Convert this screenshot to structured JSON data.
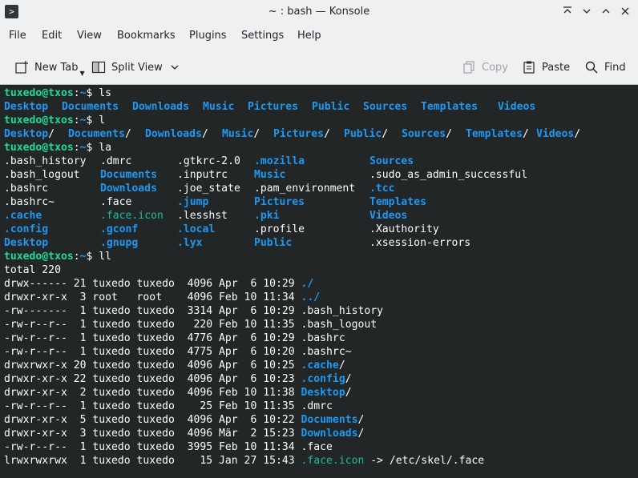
{
  "window": {
    "title": "~ : bash — Konsole"
  },
  "menu": [
    "File",
    "Edit",
    "View",
    "Bookmarks",
    "Plugins",
    "Settings",
    "Help"
  ],
  "toolbar": {
    "new_tab": "New Tab",
    "split_view": "Split View",
    "copy": "Copy",
    "paste": "Paste",
    "find": "Find"
  },
  "colors": {
    "terminal_bg": "#232627",
    "prompt": "#1cdc9a",
    "directory": "#1d99f3",
    "symlink": "#1abc9c",
    "text": "#fcfcfc"
  },
  "prompt": {
    "user_host": "tuxedo@txos",
    "sep": ":",
    "path": "~",
    "symbol": "$ "
  },
  "terminal": {
    "cmd1": "ls",
    "ls_dirs": [
      "Desktop",
      "Documents",
      "Downloads",
      "Music",
      "Pictures",
      "Public",
      "Sources",
      "Templates",
      "Videos"
    ],
    "cmd2": "l",
    "l_entries": [
      {
        "name": "Desktop",
        "suffix": "/"
      },
      {
        "name": "Documents",
        "suffix": "/"
      },
      {
        "name": "Downloads",
        "suffix": "/"
      },
      {
        "name": "Music",
        "suffix": "/"
      },
      {
        "name": "Pictures",
        "suffix": "/"
      },
      {
        "name": "Public",
        "suffix": "/"
      },
      {
        "name": "Sources",
        "suffix": "/"
      },
      {
        "name": "Templates",
        "suffix": "/"
      },
      {
        "name": "Videos",
        "suffix": "/"
      }
    ],
    "cmd3": "la",
    "la_columns": [
      [
        {
          "t": ".bash_history",
          "k": "plain"
        },
        {
          "t": ".bash_logout",
          "k": "plain"
        },
        {
          "t": ".bashrc",
          "k": "plain"
        },
        {
          "t": ".bashrc~",
          "k": "plain"
        },
        {
          "t": ".cache",
          "k": "dir"
        },
        {
          "t": ".config",
          "k": "dir"
        },
        {
          "t": "Desktop",
          "k": "dir"
        }
      ],
      [
        {
          "t": ".dmrc",
          "k": "plain"
        },
        {
          "t": "Documents",
          "k": "dir"
        },
        {
          "t": "Downloads",
          "k": "dir"
        },
        {
          "t": ".face",
          "k": "plain"
        },
        {
          "t": ".face.icon",
          "k": "link"
        },
        {
          "t": ".gconf",
          "k": "dir"
        },
        {
          "t": ".gnupg",
          "k": "dir"
        }
      ],
      [
        {
          "t": ".gtkrc-2.0",
          "k": "plain"
        },
        {
          "t": ".inputrc",
          "k": "plain"
        },
        {
          "t": ".joe_state",
          "k": "plain"
        },
        {
          "t": ".jump",
          "k": "dir"
        },
        {
          "t": ".lesshst",
          "k": "plain"
        },
        {
          "t": ".local",
          "k": "dir"
        },
        {
          "t": ".lyx",
          "k": "dir"
        }
      ],
      [
        {
          "t": ".mozilla",
          "k": "dir"
        },
        {
          "t": "Music",
          "k": "dir"
        },
        {
          "t": ".pam_environment",
          "k": "plain"
        },
        {
          "t": "Pictures",
          "k": "dir"
        },
        {
          "t": ".pki",
          "k": "dir"
        },
        {
          "t": ".profile",
          "k": "plain"
        },
        {
          "t": "Public",
          "k": "plain_dir"
        }
      ],
      [
        {
          "t": "Sources",
          "k": "dir"
        },
        {
          "t": ".sudo_as_admin_successful",
          "k": "plain"
        },
        {
          "t": ".tcc",
          "k": "dir"
        },
        {
          "t": "Templates",
          "k": "dir"
        },
        {
          "t": "Videos",
          "k": "dir"
        },
        {
          "t": ".Xauthority",
          "k": "plain"
        },
        {
          "t": ".xsession-errors",
          "k": "plain"
        }
      ]
    ],
    "cmd4": "ll",
    "total": "total 220",
    "ll_rows": [
      {
        "meta": "drwx------ 21 tuxedo tuxedo  4096 Apr  6 10:29 ",
        "name": "./",
        "k": "dirslash"
      },
      {
        "meta": "drwxr-xr-x  3 root   root    4096 Feb 10 11:34 ",
        "name": "../",
        "k": "dirslash"
      },
      {
        "meta": "-rw-------  1 tuxedo tuxedo  3314 Apr  6 10:29 ",
        "name": ".bash_history",
        "k": "plain"
      },
      {
        "meta": "-rw-r--r--  1 tuxedo tuxedo   220 Feb 10 11:35 ",
        "name": ".bash_logout",
        "k": "plain"
      },
      {
        "meta": "-rw-r--r--  1 tuxedo tuxedo  4776 Apr  6 10:29 ",
        "name": ".bashrc",
        "k": "plain"
      },
      {
        "meta": "-rw-r--r--  1 tuxedo tuxedo  4775 Apr  6 10:20 ",
        "name": ".bashrc~",
        "k": "plain"
      },
      {
        "meta": "drwxrwxr-x 20 tuxedo tuxedo  4096 Apr  6 10:25 ",
        "name": ".cache",
        "k": "dir",
        "suffix": "/"
      },
      {
        "meta": "drwxr-xr-x 22 tuxedo tuxedo  4096 Apr  6 10:23 ",
        "name": ".config",
        "k": "dir",
        "suffix": "/"
      },
      {
        "meta": "drwxr-xr-x  2 tuxedo tuxedo  4096 Feb 10 11:38 ",
        "name": "Desktop",
        "k": "dir",
        "suffix": "/"
      },
      {
        "meta": "-rw-r--r--  1 tuxedo tuxedo    25 Feb 10 11:35 ",
        "name": ".dmrc",
        "k": "plain"
      },
      {
        "meta": "drwxr-xr-x  5 tuxedo tuxedo  4096 Apr  6 10:22 ",
        "name": "Documents",
        "k": "dir",
        "suffix": "/"
      },
      {
        "meta": "drwxr-xr-x  3 tuxedo tuxedo  4096 Mär  2 15:23 ",
        "name": "Downloads",
        "k": "dir",
        "suffix": "/"
      },
      {
        "meta": "-rw-r--r--  1 tuxedo tuxedo  3995 Feb 10 11:34 ",
        "name": ".face",
        "k": "plain"
      },
      {
        "meta": "lrwxrwxrwx  1 tuxedo tuxedo    15 Jan 27 15:43 ",
        "name": ".face.icon",
        "k": "link",
        "suffix": " -> /etc/skel/.face"
      }
    ]
  }
}
